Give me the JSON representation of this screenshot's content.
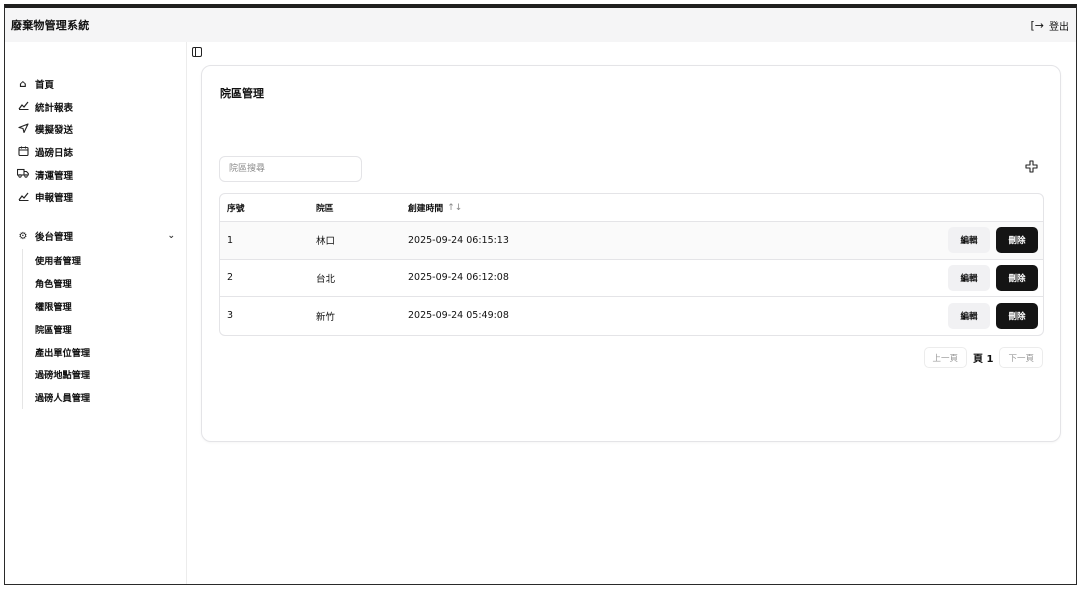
{
  "app": {
    "title": "廢棄物管理系統",
    "logout_label": "登出"
  },
  "sidebar": {
    "items": [
      {
        "label": "首頁",
        "icon": "home-icon"
      },
      {
        "label": "統計報表",
        "icon": "chart-icon"
      },
      {
        "label": "模擬發送",
        "icon": "send-icon"
      },
      {
        "label": "過磅日誌",
        "icon": "calendar-icon"
      },
      {
        "label": "清運管理",
        "icon": "truck-icon"
      },
      {
        "label": "申報管理",
        "icon": "chart-icon"
      }
    ],
    "admin": {
      "label": "後台管理",
      "icon": "gear-icon",
      "subitems": [
        "使用者管理",
        "角色管理",
        "權限管理",
        "院區管理",
        "產出單位管理",
        "過磅地點管理",
        "過磅人員管理"
      ]
    }
  },
  "main": {
    "title": "院區管理",
    "search_placeholder": "院區搜尋",
    "table": {
      "headers": {
        "id": "序號",
        "district": "院區",
        "created": "創建時間"
      },
      "rows": [
        {
          "id": "1",
          "district": "林口",
          "created": "2025-09-24 06:15:13"
        },
        {
          "id": "2",
          "district": "台北",
          "created": "2025-09-24 06:12:08"
        },
        {
          "id": "3",
          "district": "新竹",
          "created": "2025-09-24 05:49:08"
        }
      ],
      "edit_label": "編輯",
      "delete_label": "刪除"
    },
    "pagination": {
      "prev_label": "上一頁",
      "page_label": "頁 1",
      "next_label": "下一頁"
    }
  },
  "colors": {
    "accent_dark": "#141414",
    "topbar_bg": "#f5f5f6",
    "border": "#e4e4e7"
  }
}
